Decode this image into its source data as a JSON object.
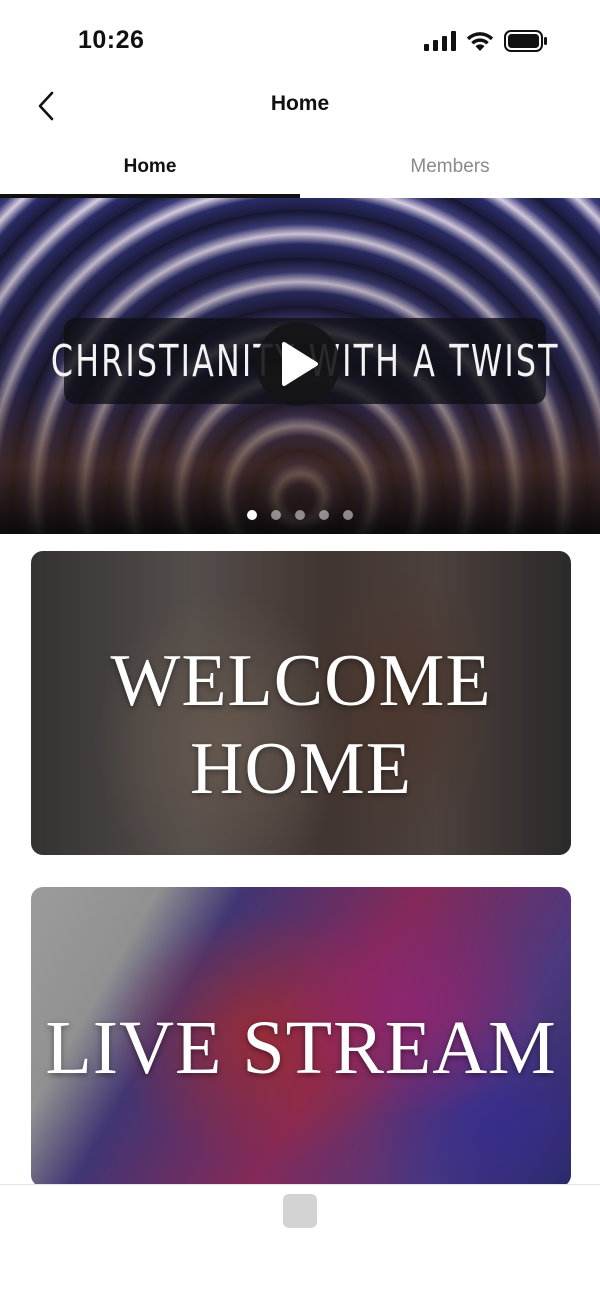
{
  "status_bar": {
    "time": "10:26",
    "icons": [
      "cellular-signal-icon",
      "wifi-icon",
      "battery-icon"
    ]
  },
  "nav": {
    "title": "Home",
    "back_icon": "chevron-left-icon"
  },
  "tabs": [
    {
      "label": "Home",
      "active": true
    },
    {
      "label": "Members",
      "active": false
    }
  ],
  "hero": {
    "banner_text": "CHRISTIANITY WITH A TWIST",
    "play_icon": "play-icon",
    "slide_count": 5,
    "active_slide": 1
  },
  "cards": [
    {
      "title_line1": "WELCOME",
      "title_line2": "HOME"
    },
    {
      "title": "LIVE STREAM"
    }
  ],
  "bottom_bar": {
    "icon": "placeholder-icon"
  },
  "colors": {
    "text_primary": "#111111",
    "text_inactive": "#8a8a8a",
    "tab_indicator": "#111111",
    "background": "#ffffff"
  }
}
